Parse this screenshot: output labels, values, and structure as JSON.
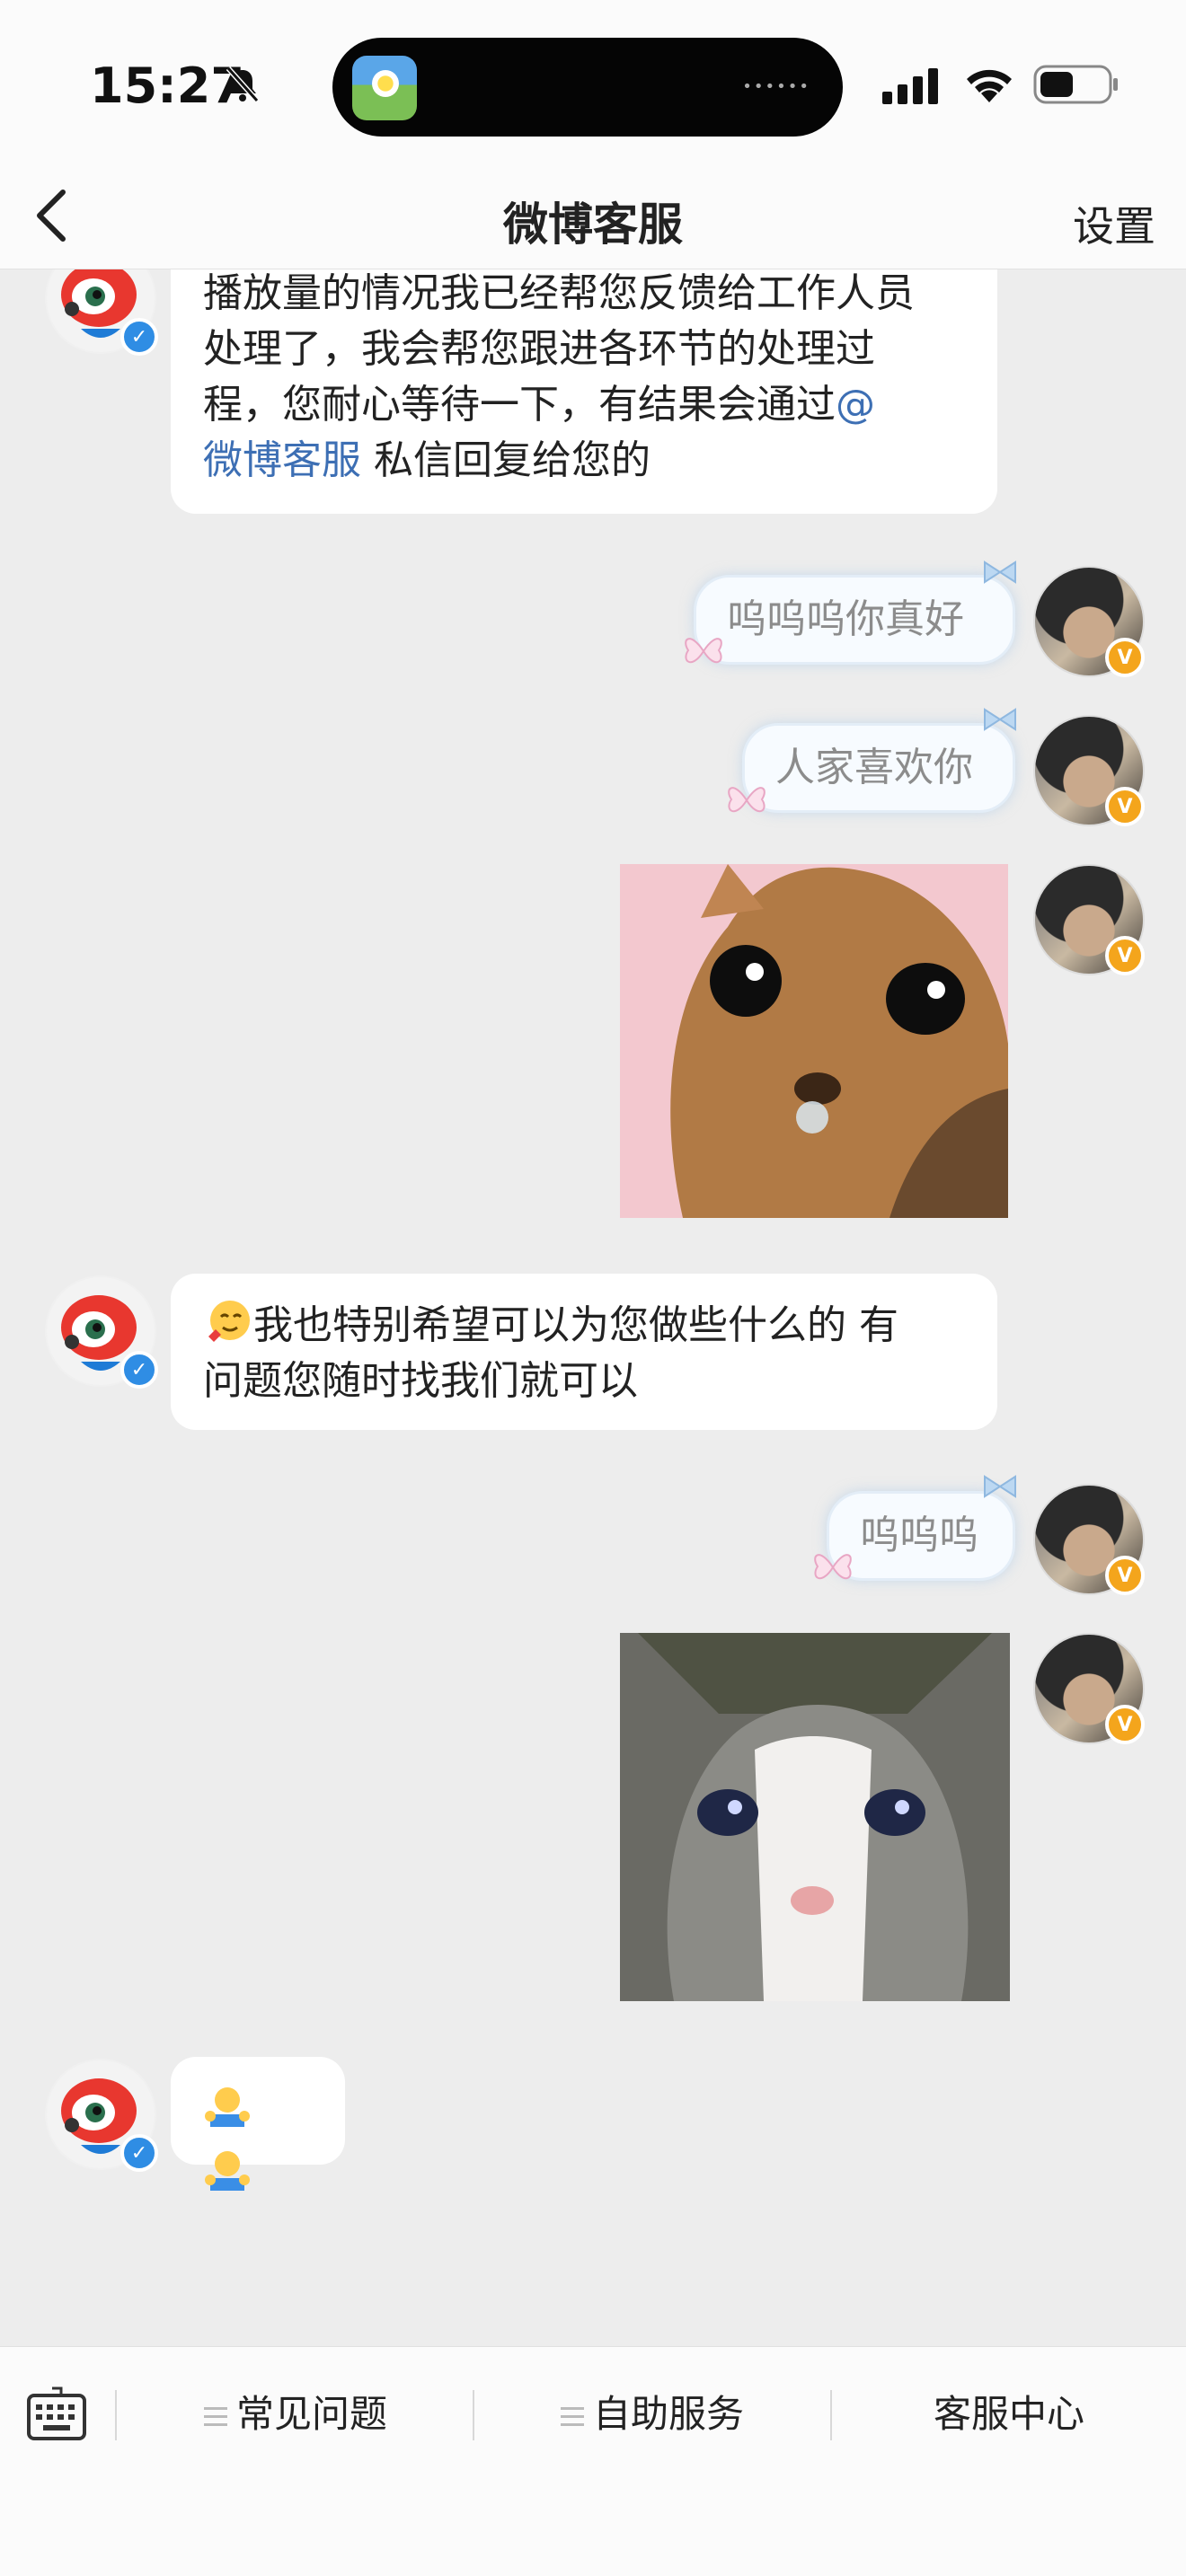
{
  "status_bar": {
    "time": "15:27"
  },
  "nav": {
    "title": "微博客服",
    "settings_label": "设置"
  },
  "messages": {
    "m1": {
      "line1": "播放量的情况我已经帮您反馈给工作人员",
      "line2": "处理了，我会帮您跟进各环节的处理过",
      "line3_text": "程，您耐心等待一下，有结果会通过",
      "line3_link": "@",
      "line4_link": "微博客服",
      "line4_text": " 私信回复给您的"
    },
    "m2": {
      "text": "呜呜呜你真好"
    },
    "m3": {
      "text": "人家喜欢你"
    },
    "m5": {
      "line1": "我也特别希望可以为您做些什么的 有",
      "line2": "问题您随时找我们就可以"
    },
    "m6": {
      "text": "呜呜呜"
    }
  },
  "bottom_bar": {
    "items": [
      {
        "label": "常见问题"
      },
      {
        "label": "自助服务"
      },
      {
        "label": "客服中心"
      }
    ]
  },
  "colors": {
    "link": "#3d6fb4",
    "badge_verify": "#2f8de4",
    "badge_vip": "#f4a51c",
    "background": "#ededed"
  }
}
